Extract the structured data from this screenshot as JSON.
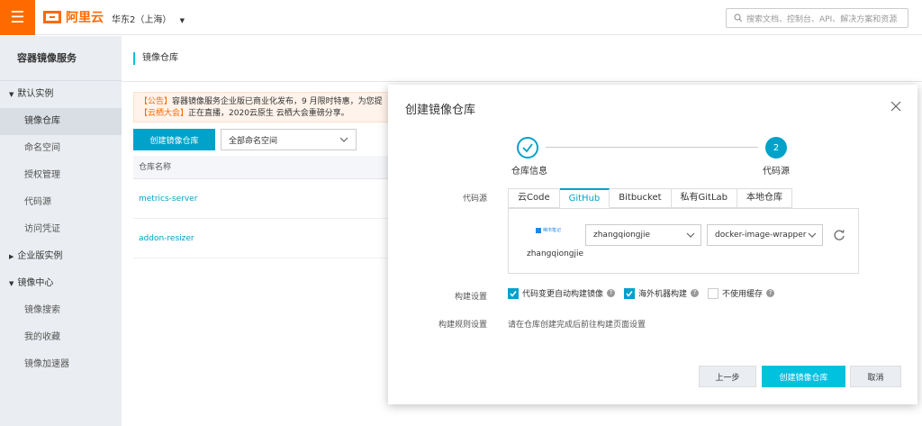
{
  "topbar": {
    "menu_icon": "menu-icon",
    "logo_text": "阿里云",
    "region": "华东2（上海）",
    "search_placeholder": "搜索文档、控制台、API、解决方案和资源"
  },
  "sidebar": {
    "title": "容器镜像服务",
    "groups": [
      {
        "label": "默认实例",
        "expanded": true,
        "items": [
          {
            "label": "镜像仓库",
            "active": true
          },
          {
            "label": "命名空间"
          },
          {
            "label": "授权管理"
          },
          {
            "label": "代码源"
          },
          {
            "label": "访问凭证"
          }
        ]
      },
      {
        "label": "企业版实例",
        "expanded": false
      },
      {
        "label": "镜像中心",
        "expanded": true,
        "items": [
          {
            "label": "镜像搜索"
          },
          {
            "label": "我的收藏"
          },
          {
            "label": "镜像加速器"
          }
        ]
      }
    ]
  },
  "main": {
    "breadcrumb": "镜像仓库",
    "notice_line1_tag": "【公告】",
    "notice_line1": "容器镜像服务企业版已商业化发布，9 月限时特惠，为您提",
    "notice_line2_tag": "【云栖大会】",
    "notice_line2": "正在直播，2020云原生 云栖大会重磅分享。",
    "create_button": "创建镜像仓库",
    "namespace_select": "全部命名空间",
    "table_header": "仓库名称",
    "rows": [
      "metrics-server",
      "addon-resizer"
    ]
  },
  "modal": {
    "title": "创建镜像仓库",
    "steps": [
      {
        "label": "仓库信息",
        "status": "done"
      },
      {
        "label": "代码源",
        "number": "2",
        "status": "active"
      }
    ],
    "source_label": "代码源",
    "tabs": [
      "云Code",
      "GitHub",
      "Bitbucket",
      "私有GitLab",
      "本地仓库"
    ],
    "active_tab": "GitHub",
    "badge_text": "稀市笔记",
    "account_name": "zhangqiongjie",
    "org_select": "zhangqiongjie",
    "repo_select": "docker-image-wrapper",
    "build_label": "构建设置",
    "build_options": [
      {
        "label": "代码变更自动构建镜像",
        "checked": true
      },
      {
        "label": "海外机器构建",
        "checked": true
      },
      {
        "label": "不使用缓存",
        "checked": false
      }
    ],
    "rule_label": "构建规则设置",
    "rule_hint": "请在仓库创建完成后前往构建页面设置",
    "buttons": {
      "prev": "上一步",
      "create": "创建镜像仓库",
      "cancel": "取消"
    }
  },
  "colors": {
    "brand": "#ff6a00",
    "accent": "#00a2ca",
    "primary_button": "#00c1de"
  }
}
